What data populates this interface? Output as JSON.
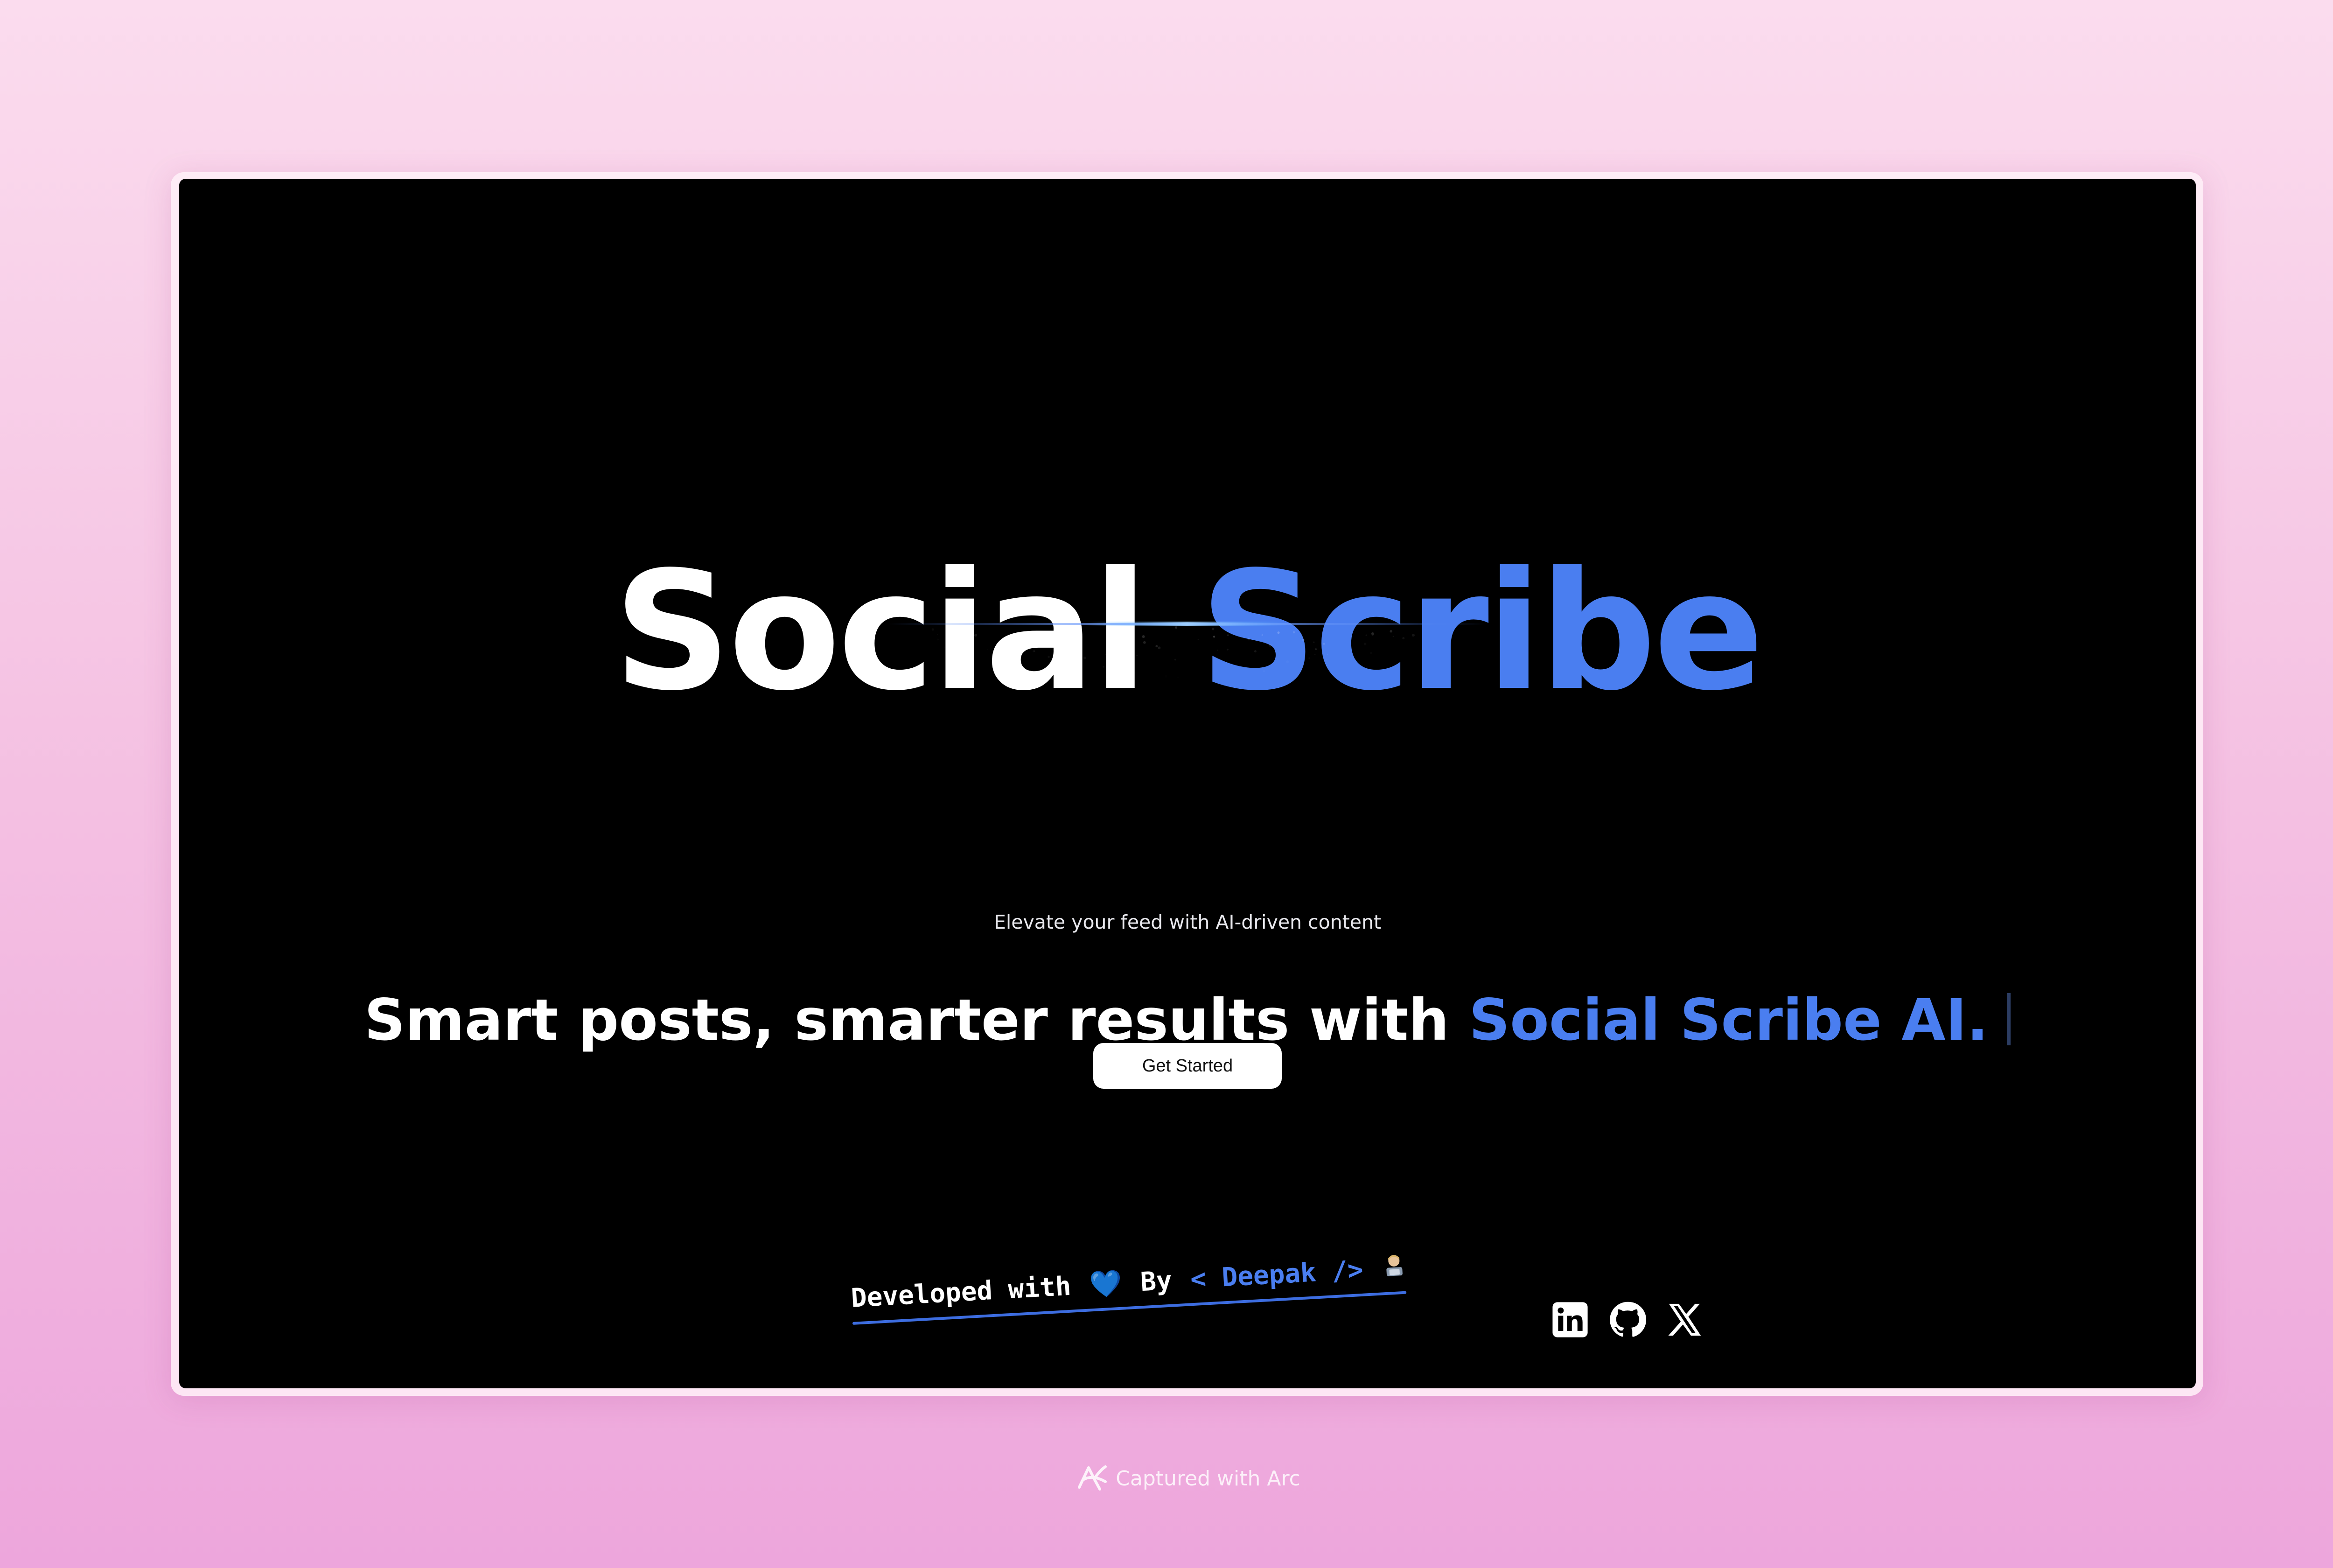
{
  "hero": {
    "title_plain": "Social",
    "title_accent": "Scribe"
  },
  "subtitle": "Elevate your feed with AI-driven content",
  "headline": {
    "plain": "Smart posts, smarter results with ",
    "accent": "Social Scribe AI."
  },
  "cta": {
    "label": "Get Started"
  },
  "footer": {
    "developed_with": "Developed with",
    "heart": "💙",
    "by": "By",
    "author": "< Deepak />",
    "links": [
      {
        "name": "linkedin",
        "icon": "linkedin-icon"
      },
      {
        "name": "github",
        "icon": "github-icon"
      },
      {
        "name": "x",
        "icon": "x-icon"
      }
    ]
  },
  "capture_badge": {
    "text": "Captured with Arc",
    "icon": "arc-icon"
  },
  "colors": {
    "accent": "#4a7ef0",
    "background": "#000000",
    "page_gradient_top": "#fbdcee",
    "page_gradient_bottom": "#eda6dc"
  }
}
